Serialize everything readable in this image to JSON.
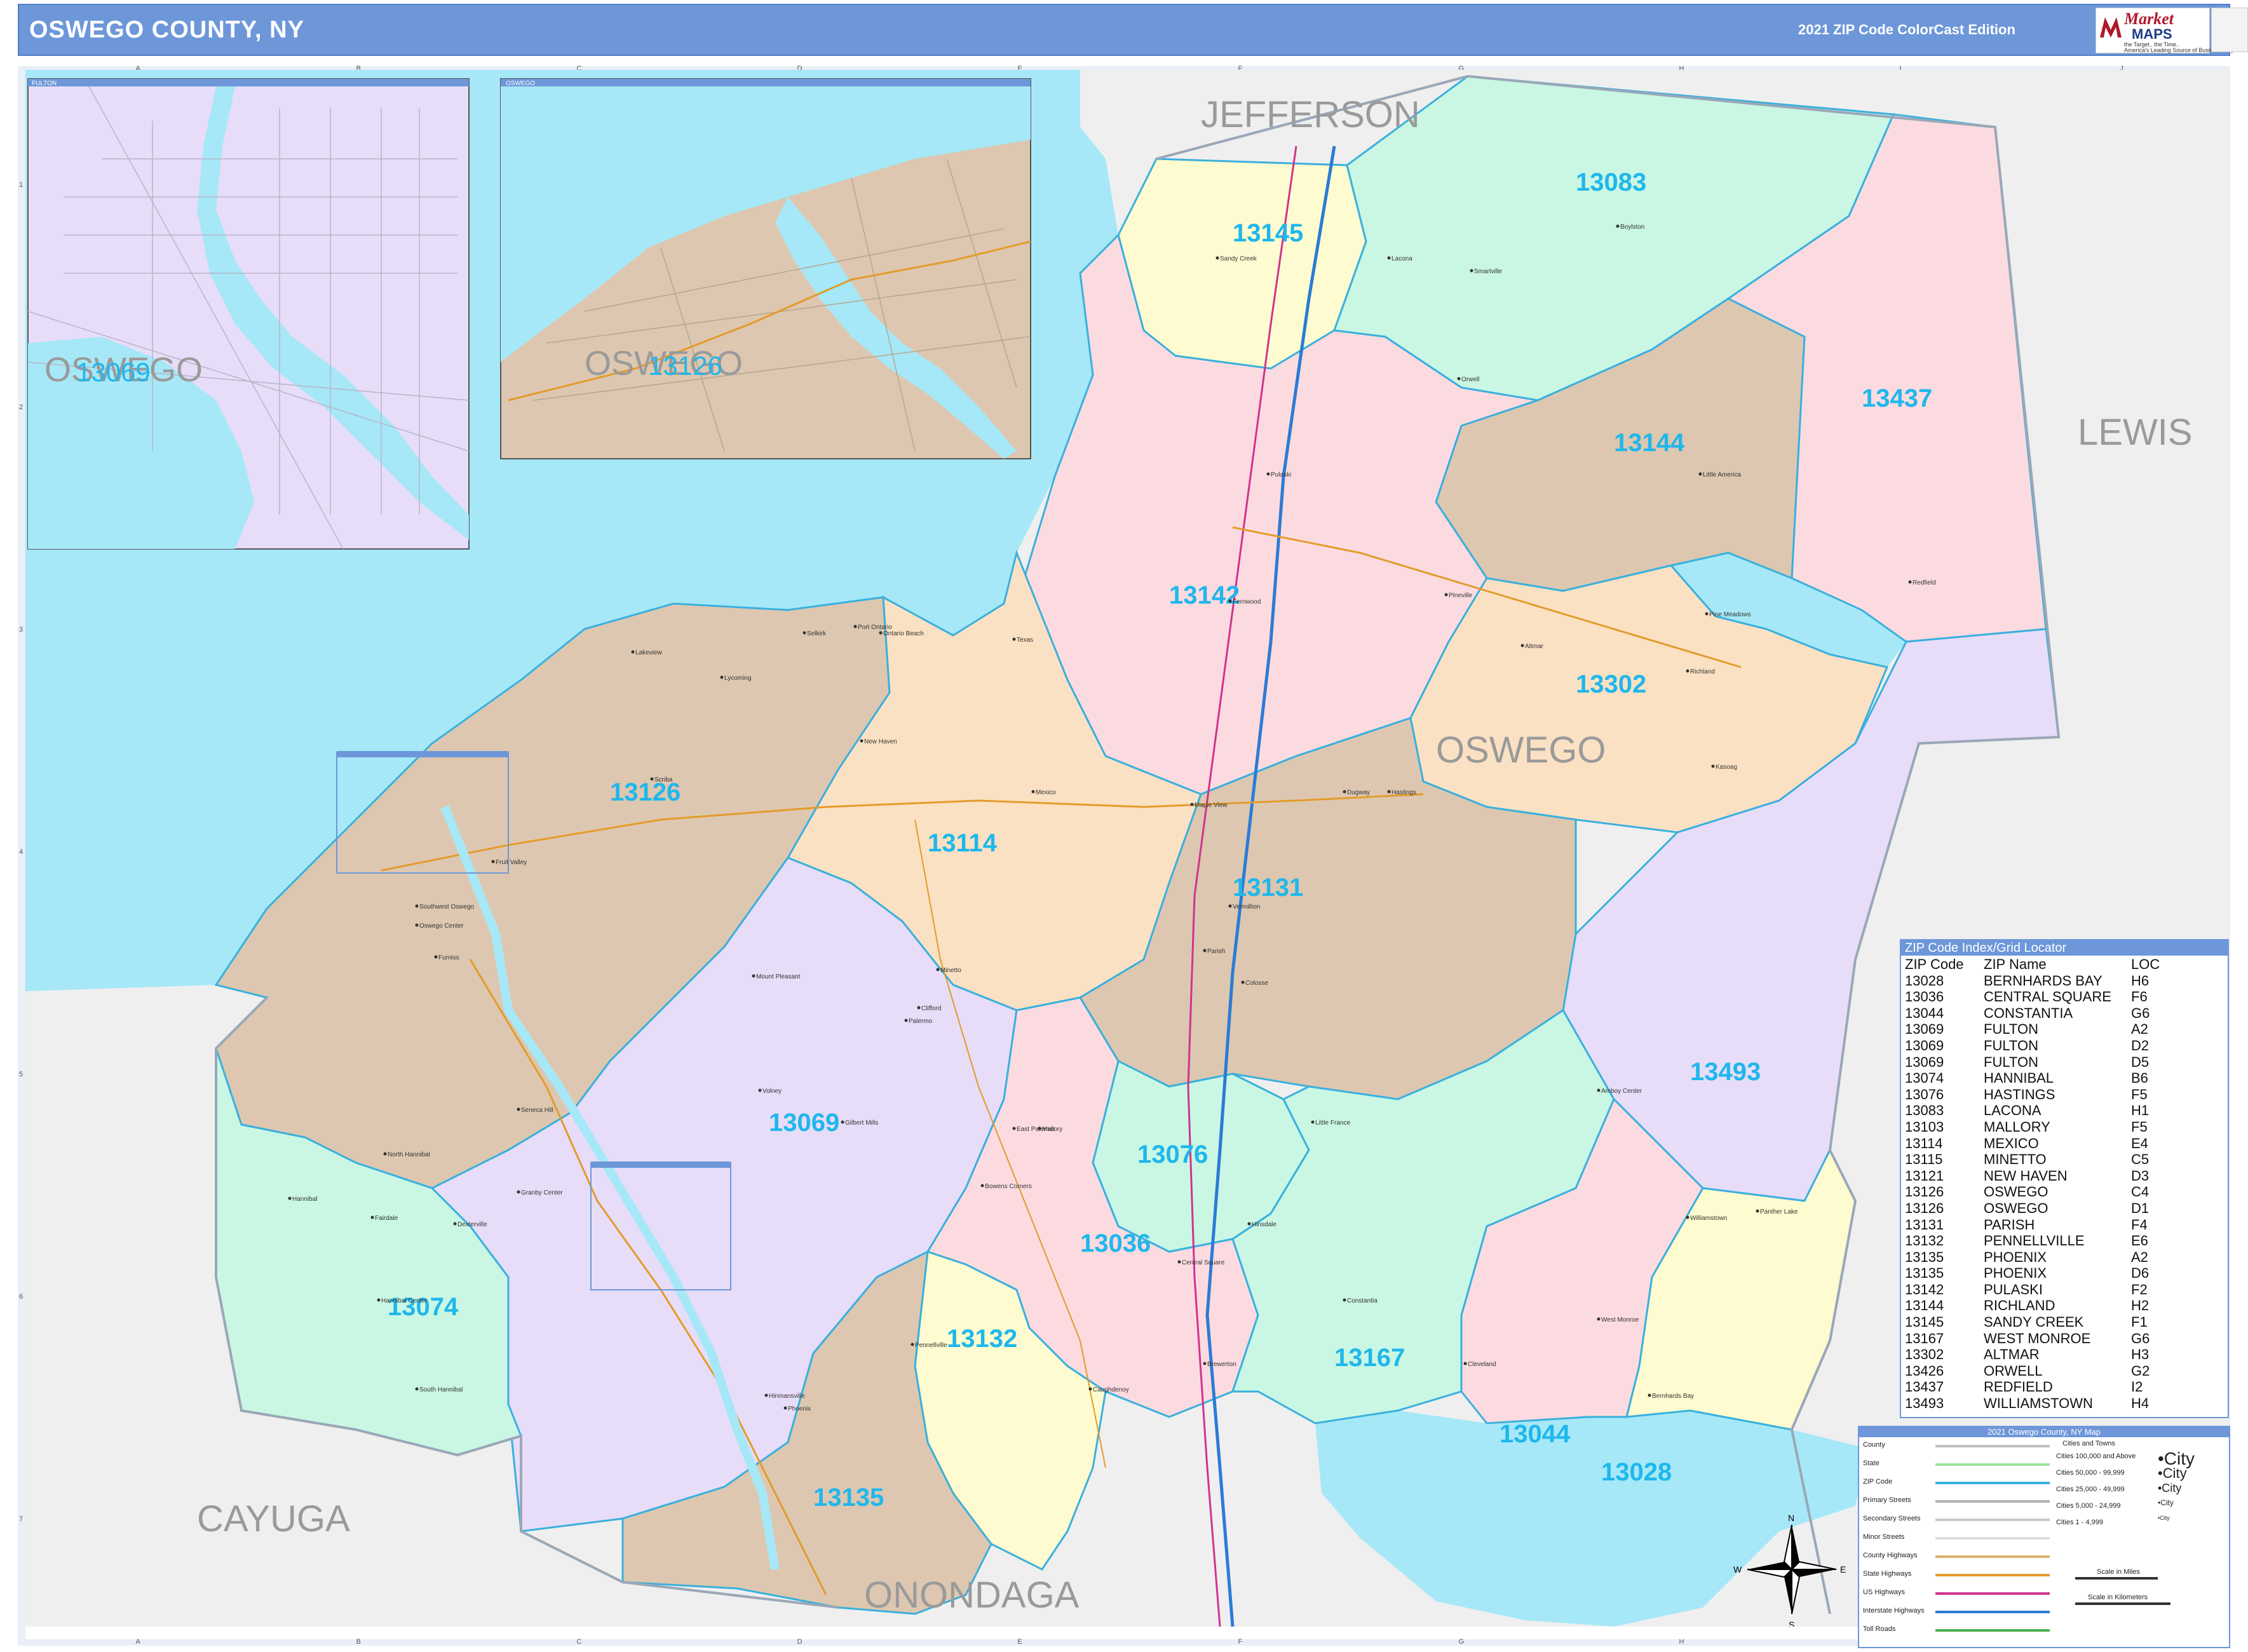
{
  "header": {
    "title": "OSWEGO COUNTY, NY",
    "edition": "2021 ZIP Code ColorCast Edition"
  },
  "logo": {
    "top": "Market",
    "main": "MAPS",
    "tagline1": "the Target.. the Time..",
    "tagline2": "America's Leading Source of Business Maps"
  },
  "grid": {
    "columns": [
      "A",
      "B",
      "C",
      "D",
      "E",
      "F",
      "G",
      "H",
      "I",
      "J"
    ],
    "rows": [
      "1",
      "2",
      "3",
      "4",
      "5",
      "6",
      "7"
    ]
  },
  "map": {
    "colors": {
      "water": "#a6e8f7",
      "outside": "#efefef",
      "zip_boundary": "#3ab0de",
      "zip_label": "#1fb7ec",
      "region_label": "#9a9a9a",
      "tan": "#ddc7b0",
      "peach": "#fbe1c3",
      "pink": "#fcdbe0",
      "lavender": "#e7ddf8",
      "mint": "#c9f7e4",
      "yellow": "#fdfbcf"
    },
    "region_labels": [
      "JEFFERSON",
      "LEWIS",
      "OSWEGO",
      "CAYUGA",
      "ONONDAGA"
    ],
    "zip_labels": [
      "13083",
      "13145",
      "13437",
      "13144",
      "13142",
      "13302",
      "13126",
      "13114",
      "13131",
      "13493",
      "13069",
      "13076",
      "13036",
      "13074",
      "13132",
      "13167",
      "13044",
      "13028",
      "13135"
    ],
    "inset_fulton": {
      "title": "FULTON",
      "region_label": "OSWEGO",
      "zip_label": "13069"
    },
    "inset_oswego": {
      "title": "OSWEGO",
      "region_label": "OSWEGO",
      "zip_label": "13126"
    },
    "place_names": [
      "Boylston",
      "Sandy Creek",
      "Lacona",
      "Smartville",
      "Orwell",
      "Little America",
      "Redfield",
      "Pineville",
      "Pine Meadows",
      "Altmar",
      "Kasoag",
      "Richland",
      "Pulaski",
      "Fernwood",
      "Ontario Beach",
      "Selkirk",
      "Texas",
      "Port Ontario",
      "Lakeview",
      "Lycoming",
      "Scriba",
      "New Haven",
      "Mexico",
      "Maple View",
      "Dugway",
      "Hastings",
      "Parish",
      "Colosse",
      "Vermillion",
      "Minetto",
      "Fruit Valley",
      "Southwest Oswego",
      "Oswego Center",
      "Furniss",
      "Volney",
      "Mount Pleasant",
      "Clifford",
      "Palermo",
      "Gilbert Mills",
      "East Palermo",
      "Bowens Corners",
      "Central Square",
      "Brewerton",
      "Constantia",
      "West Monroe",
      "Cleveland",
      "Bernhards Bay",
      "Williamstown",
      "Amboy Center",
      "Panther Lake",
      "Phoenix",
      "Hinmansville",
      "Pennellville",
      "North Hannibal",
      "Hannibal",
      "Fairdale",
      "Granby Center",
      "Hannibal Center",
      "South Hannibal",
      "Dexterville",
      "Seneca Hill",
      "Caughdenoy",
      "Mallory",
      "Little France",
      "Hinsdale"
    ]
  },
  "zip_index": {
    "title": "ZIP Code Index/Grid Locator",
    "columns": [
      "ZIP Code",
      "ZIP Name",
      "LOC"
    ],
    "rows": [
      [
        "13028",
        "BERNHARDS BAY",
        "H6"
      ],
      [
        "13036",
        "CENTRAL SQUARE",
        "F6"
      ],
      [
        "13044",
        "CONSTANTIA",
        "G6"
      ],
      [
        "13069",
        "FULTON",
        "A2"
      ],
      [
        "13069",
        "FULTON",
        "D2"
      ],
      [
        "13069",
        "FULTON",
        "D5"
      ],
      [
        "13074",
        "HANNIBAL",
        "B6"
      ],
      [
        "13076",
        "HASTINGS",
        "F5"
      ],
      [
        "13083",
        "LACONA",
        "H1"
      ],
      [
        "13103",
        "MALLORY",
        "F5"
      ],
      [
        "13114",
        "MEXICO",
        "E4"
      ],
      [
        "13115",
        "MINETTO",
        "C5"
      ],
      [
        "13121",
        "NEW HAVEN",
        "D3"
      ],
      [
        "13126",
        "OSWEGO",
        "C4"
      ],
      [
        "13126",
        "OSWEGO",
        "D1"
      ],
      [
        "13131",
        "PARISH",
        "F4"
      ],
      [
        "13132",
        "PENNELLVILLE",
        "E6"
      ],
      [
        "13135",
        "PHOENIX",
        "A2"
      ],
      [
        "13135",
        "PHOENIX",
        "D6"
      ],
      [
        "13142",
        "PULASKI",
        "F2"
      ],
      [
        "13144",
        "RICHLAND",
        "H2"
      ],
      [
        "13145",
        "SANDY CREEK",
        "F1"
      ],
      [
        "13167",
        "WEST MONROE",
        "G6"
      ],
      [
        "13302",
        "ALTMAR",
        "H3"
      ],
      [
        "13426",
        "ORWELL",
        "G2"
      ],
      [
        "13437",
        "REDFIELD",
        "I2"
      ],
      [
        "13493",
        "WILLIAMSTOWN",
        "H4"
      ]
    ]
  },
  "map_key": {
    "title": "2021 Oswego County, NY Map",
    "line_items": [
      "County",
      "State",
      "ZIP Code",
      "Primary Streets",
      "Secondary Streets",
      "Minor Streets",
      "County Highways",
      "State Highways",
      "US Highways",
      "Interstate Highways",
      "Toll Roads"
    ],
    "line_colors": [
      "#bfbfbf",
      "#9de39d",
      "#3ab0de",
      "#b0b0b0",
      "#c8c8c8",
      "#dddddd",
      "#d6b36a",
      "#e39b2b",
      "#d0338f",
      "#2b7bd6",
      "#4caf50"
    ],
    "cities_header": "Cities and Towns",
    "city_classes": [
      {
        "label": "Cities 100,000 and Above",
        "sample": "City"
      },
      {
        "label": "Cities 50,000 - 99,999",
        "sample": "City"
      },
      {
        "label": "Cities 25,000 - 49,999",
        "sample": "City"
      },
      {
        "label": "Cities 5,000 - 24,999",
        "sample": "City"
      },
      {
        "label": "Cities 1 - 4,999",
        "sample": "City"
      }
    ],
    "scale_miles": "Scale in Miles",
    "scale_km": "Scale in Kilometers"
  },
  "compass": {
    "n": "N",
    "s": "S",
    "e": "E",
    "w": "W"
  }
}
